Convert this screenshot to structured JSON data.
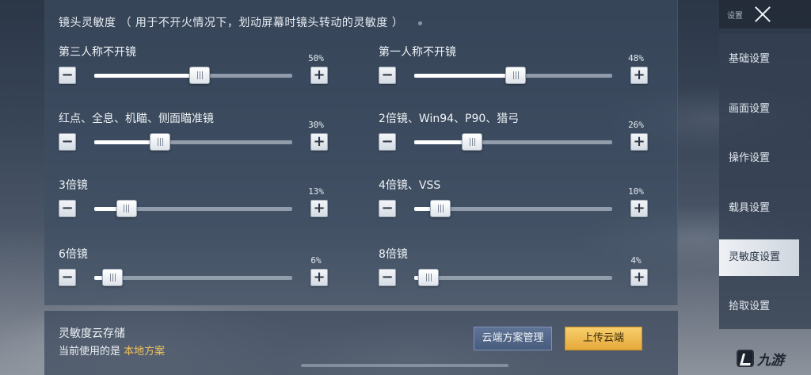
{
  "header": {
    "title": "镜头灵敏度",
    "subtitle": "（ 用于不开火情况下，划动屏幕时镜头转动的灵敏度 ）"
  },
  "controls": {
    "minus": "−",
    "plus": "+"
  },
  "sensitivity": [
    {
      "label": "第三人称不开镜",
      "value": 0.5,
      "display": "50%"
    },
    {
      "label": "第一人称不开镜",
      "value": 0.48,
      "display": "48%"
    },
    {
      "label": "红点、全息、机瞄、侧面瞄准镜",
      "value": 0.3,
      "display": "30%"
    },
    {
      "label": "2倍镜、Win94、P90、猎弓",
      "value": 0.26,
      "display": "26%"
    },
    {
      "label": "3倍镜",
      "value": 0.13,
      "display": "13%"
    },
    {
      "label": "4倍镜、VSS",
      "value": 0.1,
      "display": "10%"
    },
    {
      "label": "6倍镜",
      "value": 0.06,
      "display": "6%"
    },
    {
      "label": "8倍镜",
      "value": 0.04,
      "display": "4%"
    }
  ],
  "cloud": {
    "title": "灵敏度云存储",
    "current_prefix": "当前使用的是",
    "current_name": "本地方案",
    "manage_label": "云端方案管理",
    "upload_label": "上传云端"
  },
  "sidebar": {
    "title": "设置",
    "items": [
      {
        "label": "基础设置",
        "active": false
      },
      {
        "label": "画面设置",
        "active": false
      },
      {
        "label": "操作设置",
        "active": false
      },
      {
        "label": "载具设置",
        "active": false
      },
      {
        "label": "灵敏度设置",
        "active": true
      },
      {
        "label": "拾取设置",
        "active": false
      }
    ]
  },
  "watermark": {
    "text": "九游"
  },
  "colors": {
    "accent_gold": "#f0c15b",
    "upload_button": "#e6aa3b",
    "active_menu": "#eef1f5"
  }
}
